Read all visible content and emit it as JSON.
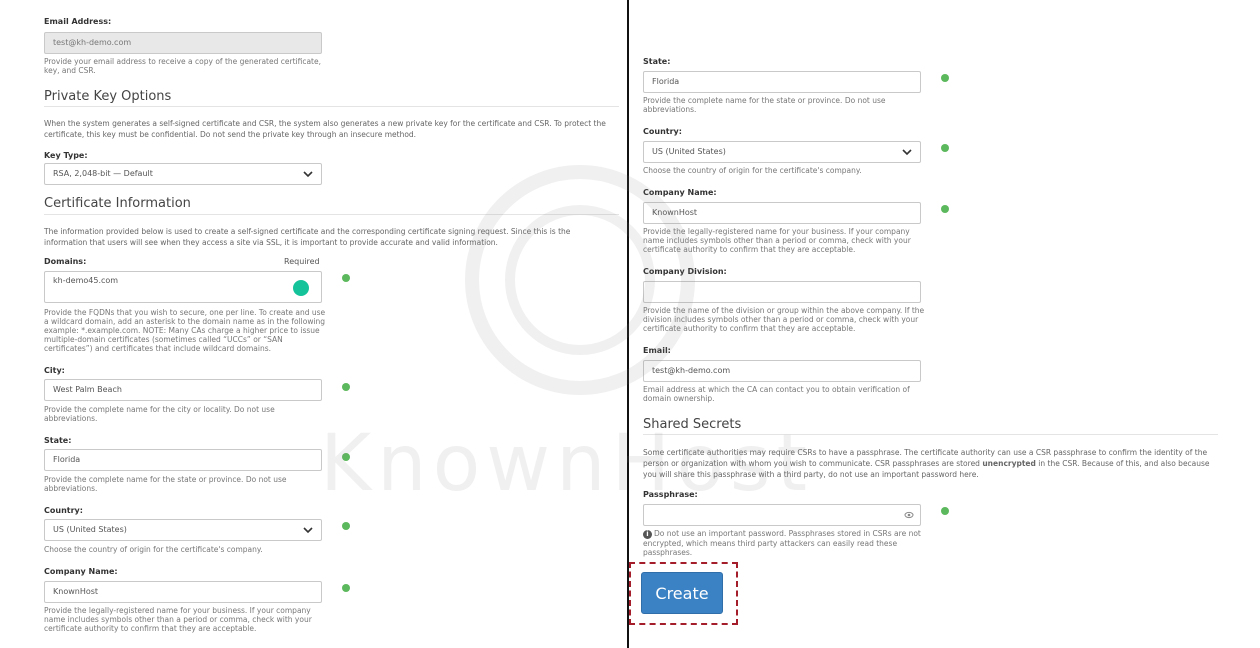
{
  "left": {
    "email": {
      "label": "Email Address:",
      "value": "test@kh-demo.com",
      "help": "Provide your email address to receive a copy of the generated certificate, key, and CSR."
    },
    "private_key": {
      "title": "Private Key Options",
      "intro": "When the system generates a self-signed certificate and CSR, the system also generates a new private key for the certificate and CSR. To protect the certificate, this key must be confidential. Do not send the private key through an insecure method.",
      "key_type_label": "Key Type:",
      "key_type_value": "RSA, 2,048-bit — Default"
    },
    "cert_info": {
      "title": "Certificate Information",
      "intro": "The information provided below is used to create a self-signed certificate and the corresponding certificate signing request. Since this is the information that users will see when they access a site via SSL, it is important to provide accurate and valid information.",
      "domains_label": "Domains:",
      "required_label": "Required",
      "domains_value": "kh-demo45.com",
      "domains_help": "Provide the FQDNs that you wish to secure, one per line. To create and use a wildcard domain, add an asterisk to the domain name as in the following example: *.example.com. NOTE: Many CAs charge a higher price to issue multiple-domain certificates (sometimes called “UCCs” or “SAN certificates”) and certificates that include wildcard domains.",
      "city_label": "City:",
      "city_value": "West Palm Beach",
      "city_help": "Provide the complete name for the city or locality. Do not use abbreviations.",
      "state_label": "State:",
      "state_value": "Florida",
      "state_help": "Provide the complete name for the state or province. Do not use abbreviations.",
      "country_label": "Country:",
      "country_value": "US (United States)",
      "country_help": "Choose the country of origin for the certificate's company.",
      "company_label": "Company Name:",
      "company_value": "KnownHost",
      "company_help": "Provide the legally-registered name for your business. If your company name includes symbols other than a period or comma, check with your certificate authority to confirm that they are acceptable."
    }
  },
  "right": {
    "state_label": "State:",
    "state_value": "Florida",
    "state_help": "Provide the complete name for the state or province. Do not use abbreviations.",
    "country_label": "Country:",
    "country_value": "US (United States)",
    "country_help": "Choose the country of origin for the certificate's company.",
    "company_label": "Company Name:",
    "company_value": "KnownHost",
    "company_help": "Provide the legally-registered name for your business. If your company name includes symbols other than a period or comma, check with your certificate authority to confirm that they are acceptable.",
    "division_label": "Company Division:",
    "division_value": "",
    "division_help": "Provide the name of the division or group within the above company. If the division includes symbols other than a period or comma, check with your certificate authority to confirm that they are acceptable.",
    "email_label": "Email:",
    "email_value": "test@kh-demo.com",
    "email_help": "Email address at which the CA can contact you to obtain verification of domain ownership.",
    "shared_secrets": {
      "title": "Shared Secrets",
      "intro_1": "Some certificate authorities may require CSRs to have a passphrase. The certificate authority can use a CSR passphrase to confirm the identity of the person or organization with whom you wish to communicate. CSR passphrases are stored",
      "intro_bold": "unencrypted",
      "intro_2": "in the CSR. Because of this, and also because you will share this passphrase with a third party, do not use an important password here.",
      "passphrase_label": "Passphrase:",
      "passphrase_value": "",
      "passphrase_help": "Do not use an important password. Passphrases stored in CSRs are not encrypted, which means third party attackers can easily read these passphrases."
    },
    "create_label": "Create"
  },
  "watermark_text": "KnownHost",
  "colors": {
    "primary_button": "#3b82c4",
    "success": "#5cb85c",
    "highlight": "#a31d2a"
  }
}
